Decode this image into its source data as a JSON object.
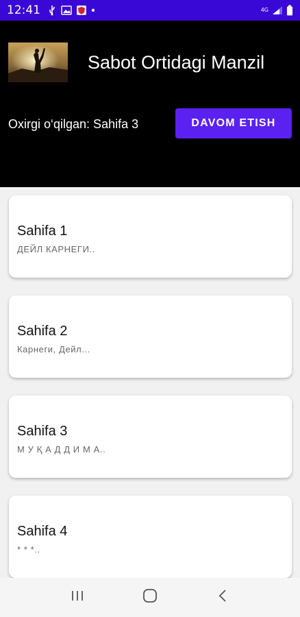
{
  "status_bar": {
    "time": "12:41",
    "network": "4G",
    "left_icons": [
      "usb-icon",
      "image-icon",
      "shield-app-icon",
      "dot-icon"
    ],
    "right_icons": [
      "signal-icon",
      "battery-icon"
    ]
  },
  "header": {
    "app_title": "Sabot Ortidagi Manzil",
    "last_read_label": "Oxirgi o‘qilgan: Sahifa 3",
    "continue_button_label": "DAVOM ETISH",
    "accent_color": "#5b21f0"
  },
  "pages": [
    {
      "title": "Sahifa 1",
      "subtitle": "ДЕЙЛ КАРНЕГИ.."
    },
    {
      "title": "Sahifa 2",
      "subtitle": "Карнеги, Дейл..."
    },
    {
      "title": "Sahifa 3",
      "subtitle": "М У Қ А Д Д И М А.."
    },
    {
      "title": "Sahifa 4",
      "subtitle": "* * *.."
    }
  ],
  "nav_bar": {
    "icons": [
      "recent-apps-icon",
      "home-icon",
      "back-icon"
    ]
  },
  "colors": {
    "status_bar": "#3a08d6",
    "header_bg": "#000000",
    "card_bg": "#ffffff",
    "list_bg": "#f1f1f1"
  }
}
